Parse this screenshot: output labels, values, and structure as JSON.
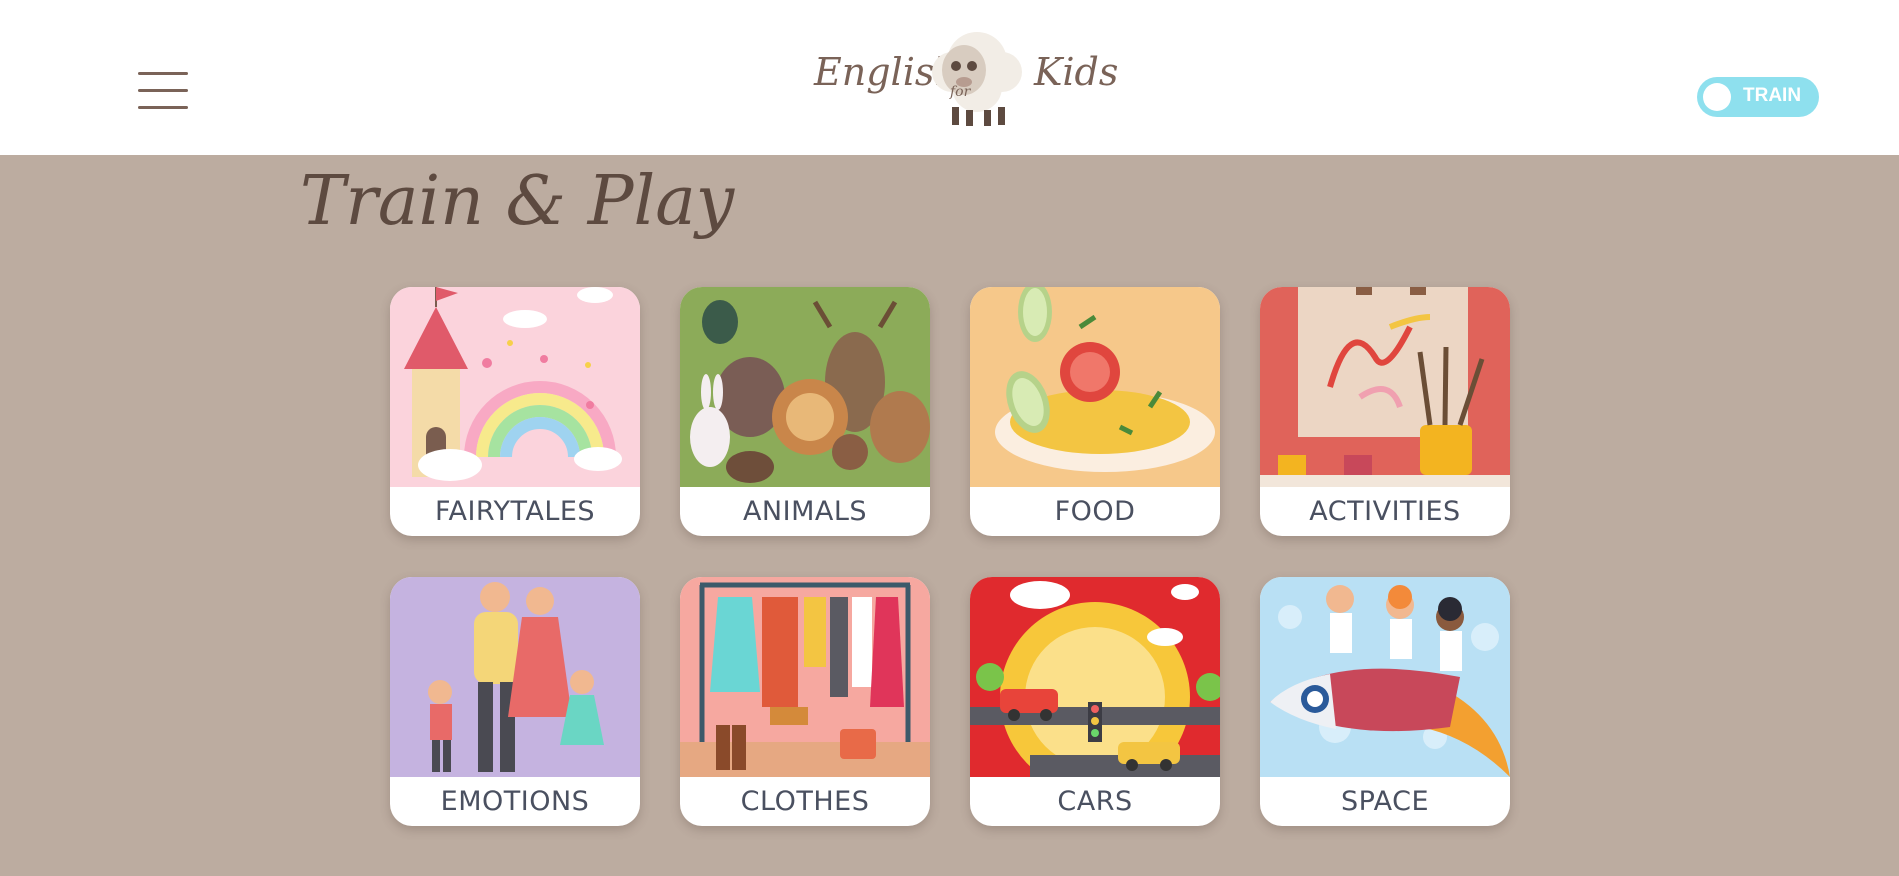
{
  "header": {
    "menu_icon": "hamburger-menu-icon",
    "logo": {
      "word1": "English",
      "word2": "for",
      "word3": "Kids",
      "mascot": "sheep-icon"
    },
    "mode_toggle": {
      "label": "TRAIN"
    }
  },
  "main": {
    "title": "Train & Play",
    "categories": [
      {
        "label": "FAIRYTALES",
        "illustration": "castle-rainbow-illustration"
      },
      {
        "label": "ANIMALS",
        "illustration": "animals-group-illustration"
      },
      {
        "label": "FOOD",
        "illustration": "food-plate-illustration"
      },
      {
        "label": "ACTIVITIES",
        "illustration": "painting-easel-illustration"
      },
      {
        "label": "EMOTIONS",
        "illustration": "family-illustration"
      },
      {
        "label": "CLOTHES",
        "illustration": "clothes-rack-illustration"
      },
      {
        "label": "CARS",
        "illustration": "cars-road-illustration"
      },
      {
        "label": "SPACE",
        "illustration": "kids-rocket-illustration"
      }
    ]
  },
  "colors": {
    "background": "#bcaca0",
    "header": "#ffffff",
    "title": "#5d4a40",
    "toggle": "#8ee0ee",
    "caption": "#4a5060"
  }
}
